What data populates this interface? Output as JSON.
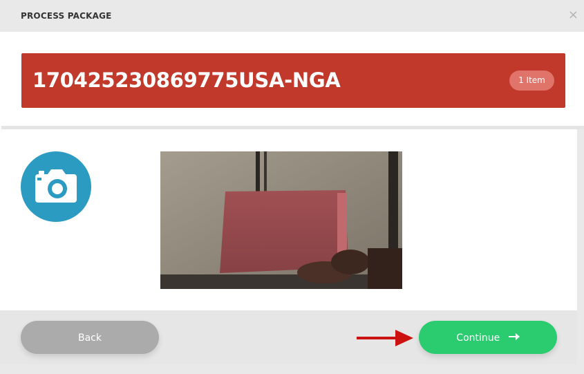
{
  "header": {
    "title": "PROCESS PACKAGE",
    "close_icon": "close-icon"
  },
  "package": {
    "tracking_number": "170425230869775USA-NGA",
    "item_badge": "1 Item"
  },
  "colors": {
    "banner": "#c0392b",
    "camera_circle": "#2b9bc1",
    "continue_button": "#2bcc6f",
    "back_button": "#ababab",
    "annotation_arrow": "#cc1111"
  },
  "capture": {
    "camera_icon": "camera-icon"
  },
  "footer": {
    "back_label": "Back",
    "continue_label": "Continue",
    "continue_icon": "arrow-right-icon"
  }
}
